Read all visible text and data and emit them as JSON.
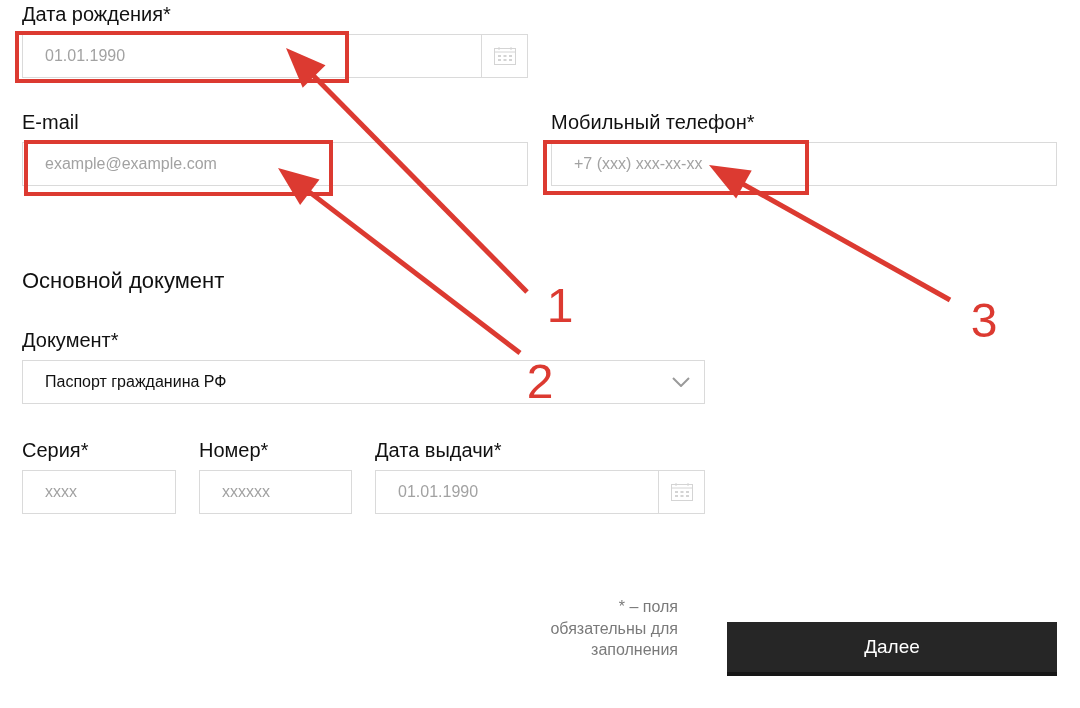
{
  "contact": {
    "rows": [
      [
        {
          "kind": "date",
          "label": "Дата рождения*",
          "placeholder": "01.01.1990"
        }
      ],
      [
        {
          "kind": "text",
          "label": "E-mail",
          "placeholder": "example@example.com"
        },
        {
          "kind": "text",
          "label": "Мобильный телефон*",
          "placeholder": "+7 (xxx) xxx-xx-xx"
        }
      ]
    ]
  },
  "document": {
    "heading": "Основной документ",
    "select": {
      "label": "Документ*",
      "value": "Паспорт гражданина РФ"
    },
    "fields": [
      {
        "kind": "text",
        "label": "Серия*",
        "placeholder": "xxxx"
      },
      {
        "kind": "text",
        "label": "Номер*",
        "placeholder": "xxxxxx"
      },
      {
        "kind": "date",
        "label": "Дата выдачи*",
        "placeholder": "01.01.1990"
      }
    ]
  },
  "footer": {
    "note": "* – поля обязательны для заполнения",
    "button": "Далее"
  },
  "annotations": [
    {
      "number": "1"
    },
    {
      "number": "2"
    },
    {
      "number": "3"
    }
  ]
}
